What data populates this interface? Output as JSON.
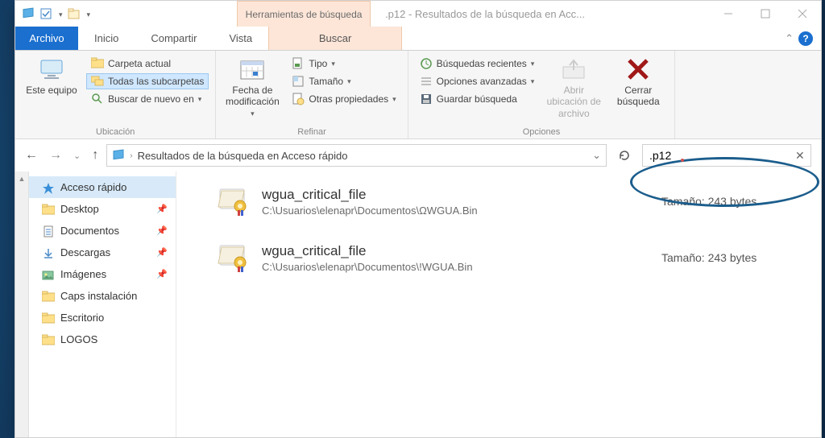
{
  "titlebar": {
    "search_tools": "Herramientas de búsqueda",
    "title": ".p12 - Resultados de la búsqueda en Acc..."
  },
  "tabs": {
    "file": "Archivo",
    "home": "Inicio",
    "share": "Compartir",
    "view": "Vista",
    "search": "Buscar"
  },
  "ribbon": {
    "this_pc": "Este equipo",
    "current_folder": "Carpeta actual",
    "all_subfolders": "Todas las subcarpetas",
    "search_again": "Buscar de nuevo en",
    "group_location": "Ubicación",
    "date_modified": "Fecha de modificación",
    "type": "Tipo",
    "size": "Tamaño",
    "other_props": "Otras propiedades",
    "group_refine": "Refinar",
    "recent_searches": "Búsquedas recientes",
    "advanced_options": "Opciones avanzadas",
    "save_search": "Guardar búsqueda",
    "open_location": "Abrir ubicación de archivo",
    "close_search": "Cerrar búsqueda",
    "group_options": "Opciones"
  },
  "address": {
    "text": "Resultados de la búsqueda en Acceso rápido"
  },
  "search": {
    "value": ".p12"
  },
  "sidebar": {
    "items": [
      {
        "label": "Acceso rápido",
        "icon": "star",
        "sel": true
      },
      {
        "label": "Desktop",
        "icon": "folder",
        "pin": true
      },
      {
        "label": "Documentos",
        "icon": "doc",
        "pin": true
      },
      {
        "label": "Descargas",
        "icon": "download",
        "pin": true
      },
      {
        "label": "Imágenes",
        "icon": "images",
        "pin": true
      },
      {
        "label": "Caps instalación",
        "icon": "folder"
      },
      {
        "label": "Escritorio",
        "icon": "folder"
      },
      {
        "label": "LOGOS",
        "icon": "folder"
      }
    ]
  },
  "results": [
    {
      "name": "wgua_critical_file",
      "path": "C:\\Usuarios\\elenapr\\Documentos\\ΩWGUA.Bin",
      "size_label": "Tamaño:",
      "size": "243 bytes"
    },
    {
      "name": "wgua_critical_file",
      "path": "C:\\Usuarios\\elenapr\\Documentos\\!WGUA.Bin",
      "size_label": "Tamaño:",
      "size": "243 bytes"
    }
  ]
}
